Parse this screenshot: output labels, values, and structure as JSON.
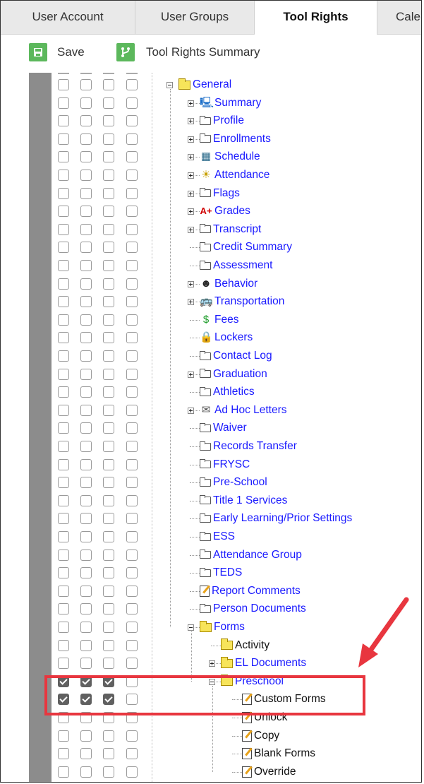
{
  "tabs": [
    "User Account",
    "User Groups",
    "Tool Rights",
    "Cale"
  ],
  "active_tab": "Tool Rights",
  "toolbar": {
    "save_label": "Save",
    "summary_label": "Tool Rights Summary"
  },
  "colors": {
    "accent": "#5cb85c",
    "link": "#1a1aff",
    "highlight": "#e8363f",
    "sidebar": "#8c8c8c"
  },
  "tree": [
    {
      "label": "General",
      "icon": "folder-icon",
      "expander": "minus"
    },
    {
      "label": "Summary",
      "icon": "monitor-icon",
      "expander": "plus"
    },
    {
      "label": "Profile",
      "icon": "page-icon",
      "expander": "plus"
    },
    {
      "label": "Enrollments",
      "icon": "page-icon",
      "expander": "plus"
    },
    {
      "label": "Schedule",
      "icon": "schedule-icon",
      "expander": "plus"
    },
    {
      "label": "Attendance",
      "icon": "attendance-icon",
      "expander": "plus"
    },
    {
      "label": "Flags",
      "icon": "page-icon",
      "expander": "plus"
    },
    {
      "label": "Grades",
      "icon": "grades-icon",
      "expander": "plus"
    },
    {
      "label": "Transcript",
      "icon": "page-icon",
      "expander": "plus"
    },
    {
      "label": "Credit Summary",
      "icon": "page-icon",
      "expander": ""
    },
    {
      "label": "Assessment",
      "icon": "page-icon",
      "expander": ""
    },
    {
      "label": "Behavior",
      "icon": "behavior-icon",
      "expander": "plus"
    },
    {
      "label": "Transportation",
      "icon": "bus-icon",
      "expander": "plus"
    },
    {
      "label": "Fees",
      "icon": "dollar-icon",
      "expander": ""
    },
    {
      "label": "Lockers",
      "icon": "lock-icon",
      "expander": ""
    },
    {
      "label": "Contact Log",
      "icon": "page-icon",
      "expander": ""
    },
    {
      "label": "Graduation",
      "icon": "page-icon",
      "expander": "plus"
    },
    {
      "label": "Athletics",
      "icon": "page-icon",
      "expander": ""
    },
    {
      "label": "Ad Hoc Letters",
      "icon": "letter-icon",
      "expander": "plus"
    },
    {
      "label": "Waiver",
      "icon": "page-icon",
      "expander": ""
    },
    {
      "label": "Records Transfer",
      "icon": "page-icon",
      "expander": ""
    },
    {
      "label": "FRYSC",
      "icon": "page-icon",
      "expander": ""
    },
    {
      "label": "Pre-School",
      "icon": "page-icon",
      "expander": ""
    },
    {
      "label": "Title 1 Services",
      "icon": "page-icon",
      "expander": ""
    },
    {
      "label": "Early Learning/Prior Settings",
      "icon": "page-icon",
      "expander": ""
    },
    {
      "label": "ESS",
      "icon": "page-icon",
      "expander": ""
    },
    {
      "label": "Attendance Group",
      "icon": "page-icon",
      "expander": ""
    },
    {
      "label": "TEDS",
      "icon": "page-icon",
      "expander": ""
    },
    {
      "label": "Report Comments",
      "icon": "note-icon",
      "expander": ""
    },
    {
      "label": "Person Documents",
      "icon": "page-icon",
      "expander": ""
    },
    {
      "label": "Forms",
      "icon": "folder-icon",
      "expander": "minus"
    },
    {
      "label": "Activity",
      "icon": "folder-icon",
      "expander": ""
    },
    {
      "label": "EL Documents",
      "icon": "folder-icon",
      "expander": "plus"
    },
    {
      "label": "Preschool",
      "icon": "folder-icon",
      "expander": "minus"
    },
    {
      "label": "Custom Forms",
      "icon": "note-icon",
      "expander": ""
    },
    {
      "label": "Unlock",
      "icon": "note-icon",
      "expander": ""
    },
    {
      "label": "Copy",
      "icon": "note-icon",
      "expander": ""
    },
    {
      "label": "Blank Forms",
      "icon": "note-icon",
      "expander": ""
    },
    {
      "label": "Override",
      "icon": "note-icon",
      "expander": ""
    }
  ],
  "checked_rows": [
    33,
    34
  ],
  "checked_columns": 3
}
